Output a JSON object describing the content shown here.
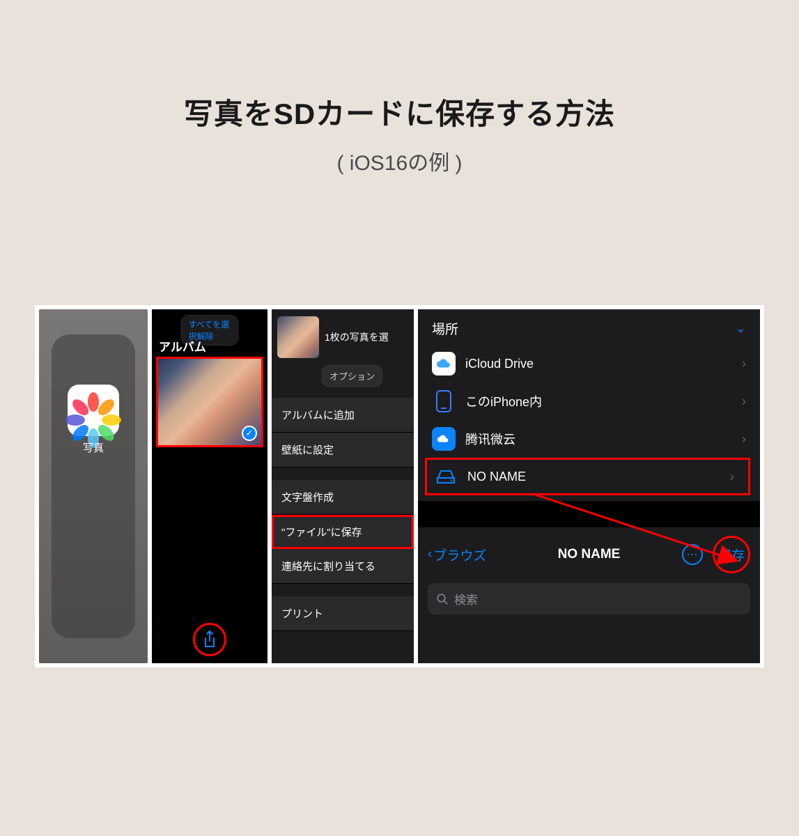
{
  "header": {
    "title": "写真をSDカードに保存する方法",
    "subtitle": "( iOS16の例 )"
  },
  "panel1": {
    "app_label": "写真"
  },
  "panel2": {
    "deselect_all": "すべてを選択解除",
    "album_title": "アルバム"
  },
  "panel3": {
    "selected_text": "1枚の写真を選",
    "options_label": "オプション",
    "items": {
      "add_to_album": "アルバムに追加",
      "set_wallpaper": "壁紙に設定",
      "create_watchface": "文字盤作成",
      "save_to_files": "\"ファイル\"に保存",
      "assign_contact": "連絡先に割り当てる",
      "print": "プリント"
    }
  },
  "panel4": {
    "locations_header": "場所",
    "locations": {
      "icloud": "iCloud Drive",
      "iphone": "このiPhone内",
      "tencent": "腾讯微云",
      "noname": "NO NAME"
    },
    "nav": {
      "back": "ブラウズ",
      "title": "NO NAME",
      "save": "保存"
    },
    "search_placeholder": "検索"
  }
}
